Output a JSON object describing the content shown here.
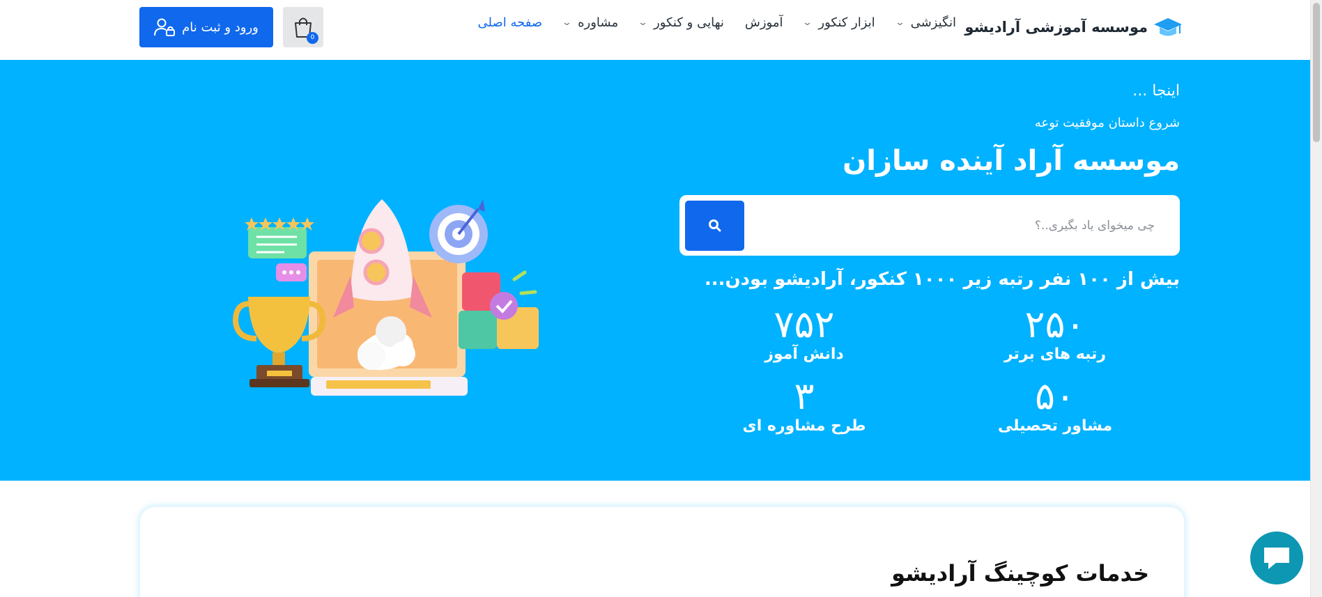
{
  "header": {
    "brand": "موسسه آموزشی آرادیشو",
    "nav": [
      {
        "label": "صفحه اصلی",
        "active": true,
        "dropdown": false
      },
      {
        "label": "مشاوره",
        "active": false,
        "dropdown": true
      },
      {
        "label": "نهایی و کنکور",
        "active": false,
        "dropdown": true
      },
      {
        "label": "آموزش",
        "active": false,
        "dropdown": false
      },
      {
        "label": "ابزار کنکور",
        "active": false,
        "dropdown": true
      },
      {
        "label": "انگیزشی",
        "active": false,
        "dropdown": true
      }
    ],
    "cart_badge": "0",
    "login_label": "ورود و ثبت نام"
  },
  "hero": {
    "line1": "اینجا ...",
    "line2": "شروع داستان موفقیت توعه",
    "title": "موسسه آراد آینده سازان",
    "search_placeholder": "چی میخوای یاد بگیری..؟",
    "tagline": "بیش از ۱۰۰ نفر رتبه زیر ۱۰۰۰ کنکور، آرادیشو بودن...",
    "stats": [
      {
        "value": "۲۵۰",
        "label": "رتبه های برتر"
      },
      {
        "value": "۷۵۲",
        "label": "دانش آموز"
      },
      {
        "value": "۵۰",
        "label": "مشاور تحصیلی"
      },
      {
        "value": "۳",
        "label": "طرح مشاوره ای"
      }
    ]
  },
  "section": {
    "title": "خدمات کوچینگ آرادیشو"
  },
  "colors": {
    "primary": "#1068ec",
    "hero_bg": "#00b2ff",
    "chat": "#0d97b3"
  },
  "icons": [
    "graduation-cap-icon",
    "chevron-down-icon",
    "shopping-bag-icon",
    "user-lock-icon",
    "search-icon",
    "chat-bubble-icon"
  ]
}
